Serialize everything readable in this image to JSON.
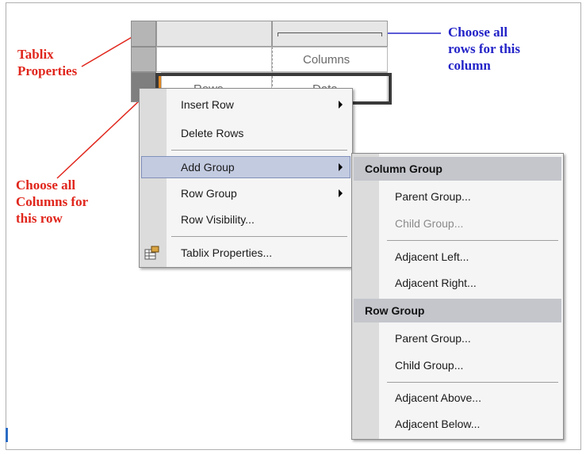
{
  "annotations": {
    "tablix_properties": "Tablix\nProperties",
    "choose_rows": "Choose all\nrows for this\ncolumn",
    "choose_columns": "Choose all\nColumns for\nthis row"
  },
  "tablix": {
    "columns_label": "Columns",
    "rows_label": "Rows",
    "data_label": "Data"
  },
  "context_menu": {
    "items": [
      {
        "label": "Insert Row"
      },
      {
        "label": "Delete Rows"
      },
      {
        "label": "Add Group"
      },
      {
        "label": "Row Group"
      },
      {
        "label": "Row Visibility..."
      },
      {
        "label": "Tablix Properties..."
      }
    ]
  },
  "submenu": {
    "column_group_header": "Column Group",
    "row_group_header": "Row Group",
    "column_items": [
      {
        "label": "Parent Group..."
      },
      {
        "label": "Child Group..."
      },
      {
        "label": "Adjacent Left..."
      },
      {
        "label": "Adjacent Right..."
      }
    ],
    "row_items": [
      {
        "label": "Parent Group..."
      },
      {
        "label": "Child Group..."
      },
      {
        "label": "Adjacent Above..."
      },
      {
        "label": "Adjacent Below..."
      }
    ]
  },
  "colors": {
    "annotation_red": "#e0261c",
    "annotation_blue": "#2424c8",
    "highlight": "#c3cbe1"
  },
  "icons": [
    "submenu-arrow-icon",
    "tablix-properties-icon"
  ]
}
